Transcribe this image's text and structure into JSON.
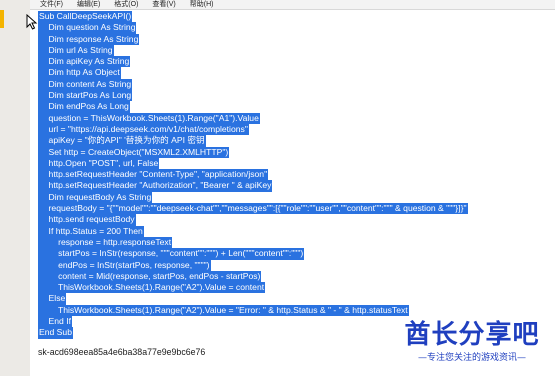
{
  "menubar": {
    "items": [
      "文件(F)",
      "编辑(E)",
      "格式(O)",
      "查看(V)",
      "帮助(H)"
    ]
  },
  "code_lines": [
    "Sub CallDeepSeekAPI()",
    "    Dim question As String",
    "    Dim response As String",
    "    Dim url As String",
    "    Dim apiKey As String",
    "    Dim http As Object",
    "    Dim content As String",
    "    Dim startPos As Long",
    "    Dim endPos As Long",
    "    question = ThisWorkbook.Sheets(1).Range(\"A1\").Value",
    "    url = \"https://api.deepseek.com/v1/chat/completions\"",
    "    apiKey = \"你的API\" '替换为你的 API 密钥",
    "    Set http = CreateObject(\"MSXML2.XMLHTTP\")",
    "    http.Open \"POST\", url, False",
    "    http.setRequestHeader \"Content-Type\", \"application/json\"",
    "    http.setRequestHeader \"Authorization\", \"Bearer \" & apiKey",
    "    Dim requestBody As String",
    "    requestBody = \"{\"\"model\"\":\"\"deepseek-chat\"\",\"\"messages\"\":[{\"\"role\"\":\"\"user\"\",\"\"content\"\":\"\"\" & question & \"\"\"}]}\"",
    "    http.send requestBody",
    "    If http.Status = 200 Then",
    "        response = http.responseText",
    "        startPos = InStr(response, \"\"\"content\"\":\"\"\") + Len(\"\"\"content\"\":\"\"\")",
    "        endPos = InStr(startPos, response, \"\"\"\")",
    "        content = Mid(response, startPos, endPos - startPos)",
    "        ThisWorkbook.Sheets(1).Range(\"A2\").Value = content",
    "    Else",
    "        ThisWorkbook.Sheets(1).Range(\"A2\").Value = \"Error: \" & http.Status & \" - \" & http.statusText",
    "    End If",
    "End Sub"
  ],
  "api_key_line": "sk-acd698eea85a4e6ba38a77e9e9bc6e76",
  "watermark": {
    "title": "酋长分享吧",
    "tagline": "—专注您关注的游戏资讯—"
  },
  "colors": {
    "selection": "#2a72e0",
    "watermark": "#1f3fbf"
  }
}
